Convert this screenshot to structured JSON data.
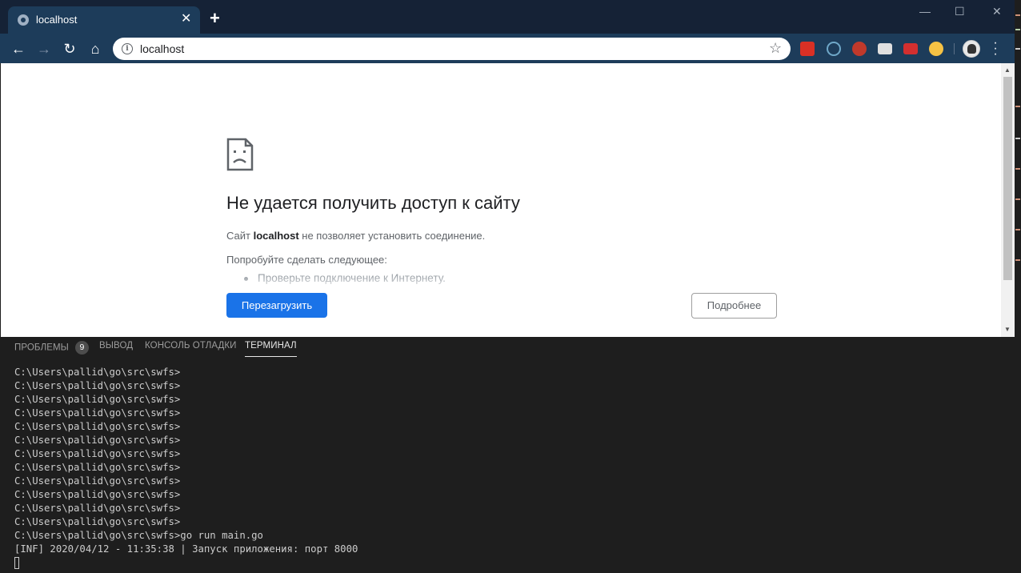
{
  "browser": {
    "tab_title": "localhost",
    "tab_close": "✕",
    "new_tab": "+",
    "url": "localhost",
    "window_controls": [
      "—",
      "☐",
      "✕"
    ]
  },
  "page": {
    "title": "Не удается получить доступ к сайту",
    "desc_prefix": "Сайт ",
    "desc_host": "localhost",
    "desc_suffix": " не позволяет установить соединение.",
    "try_text": "Попробуйте сделать следующее:",
    "suggestion": "Проверьте подключение к Интернету.",
    "reload_label": "Перезагрузить",
    "details_label": "Подробнее"
  },
  "panel": {
    "tabs": [
      {
        "label": "ПРОБЛЕМЫ",
        "badge": "9"
      },
      {
        "label": "ВЫВОД"
      },
      {
        "label": "КОНСОЛЬ ОТЛАДКИ"
      },
      {
        "label": "ТЕРМИНАЛ",
        "active": true
      }
    ]
  },
  "terminal": {
    "lines": [
      "C:\\Users\\pallid\\go\\src\\swfs>",
      "C:\\Users\\pallid\\go\\src\\swfs>",
      "C:\\Users\\pallid\\go\\src\\swfs>",
      "C:\\Users\\pallid\\go\\src\\swfs>",
      "C:\\Users\\pallid\\go\\src\\swfs>",
      "C:\\Users\\pallid\\go\\src\\swfs>",
      "C:\\Users\\pallid\\go\\src\\swfs>",
      "C:\\Users\\pallid\\go\\src\\swfs>",
      "C:\\Users\\pallid\\go\\src\\swfs>",
      "C:\\Users\\pallid\\go\\src\\swfs>",
      "C:\\Users\\pallid\\go\\src\\swfs>",
      "C:\\Users\\pallid\\go\\src\\swfs>",
      "C:\\Users\\pallid\\go\\src\\swfs>go run main.go",
      "[INF] 2020/04/12 - 11:35:38 | Запуск приложения: порт 8000"
    ]
  },
  "icons": {
    "extensions": [
      "red-a-extension-icon",
      "blue-circle-extension-icon",
      "red-stamp-extension-icon",
      "printer-extension-icon",
      "red-dots-extension-icon",
      "orange-1c-extension-icon"
    ]
  }
}
